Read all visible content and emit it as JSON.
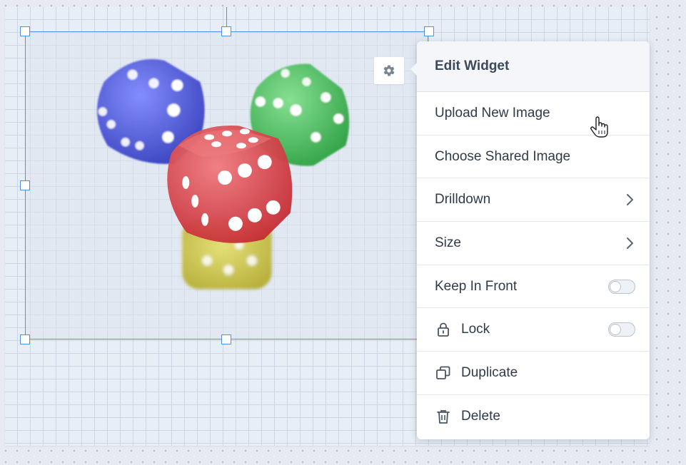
{
  "menu": {
    "title": "Edit Widget",
    "items": [
      {
        "label": "Upload New Image",
        "type": "action"
      },
      {
        "label": "Choose Shared Image",
        "type": "action"
      },
      {
        "label": "Drilldown",
        "type": "submenu"
      },
      {
        "label": "Size",
        "type": "submenu"
      },
      {
        "label": "Keep In Front",
        "type": "toggle",
        "on": false
      },
      {
        "label": "Lock",
        "type": "toggle",
        "icon": "lock-icon",
        "on": false
      },
      {
        "label": "Duplicate",
        "type": "action",
        "icon": "duplicate-icon"
      },
      {
        "label": "Delete",
        "type": "action",
        "icon": "trash-icon"
      }
    ]
  },
  "widget": {
    "type": "image",
    "content": "dice-image",
    "dice_colors": [
      "#3a43d8",
      "#2fb447",
      "#d8323a",
      "#c8c02c"
    ]
  },
  "colors": {
    "selection": "#4d93ea",
    "menu_header_bg": "#f4f6f9",
    "text": "#2f3b49"
  }
}
